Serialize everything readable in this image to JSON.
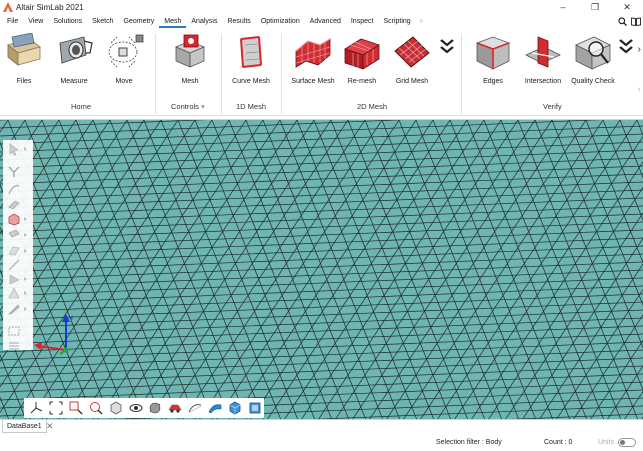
{
  "window": {
    "title": "Altair SimLab 2021",
    "controls": {
      "minimize": "–",
      "maximize": "❐",
      "close": "✕"
    }
  },
  "menu": {
    "items": [
      "File",
      "View",
      "Solutions",
      "Sketch",
      "Geometry",
      "Mesh",
      "Analysis",
      "Results",
      "Optimization",
      "Advanced",
      "Inspect",
      "Scripting"
    ],
    "active": "Mesh",
    "add_tab": "+",
    "right_icons": [
      "search-icon",
      "book-icon"
    ]
  },
  "ribbon": {
    "buttons": {
      "files": "Files",
      "measure": "Measure",
      "move": "Move",
      "mesh": "Mesh",
      "curve_mesh": "Curve Mesh",
      "surface_mesh": "Surface Mesh",
      "remesh": "Re-mesh",
      "grid_mesh": "Grid Mesh",
      "edges": "Edges",
      "intersection": "Intersection",
      "quality_check": "Quality Check"
    },
    "groups": {
      "home": "Home",
      "controls": "Controls",
      "one_d": "1D Mesh",
      "two_d": "2D Mesh",
      "verify": "Verify"
    },
    "more": "»",
    "collapse": "‹",
    "controls_arrow": "▾"
  },
  "viewport": {
    "mesh_color": "#6fb5b2",
    "mesh_line_color": "#1b2b2b",
    "triad": {
      "z_label": "z"
    }
  },
  "side_tools": [
    "select-icon",
    "split-icon",
    "curve-icon",
    "surface-icon",
    "cube-icon",
    "prism-icon",
    "plane-icon",
    "line-icon",
    "wedge-icon",
    "cone-icon",
    "pencil-icon",
    "box-select-icon",
    "layers-icon"
  ],
  "bottom_tools": [
    "axis-icon",
    "fit-icon",
    "zoom-box-icon",
    "zoom-icon",
    "view-cube-icon",
    "eye-icon",
    "hide-icon",
    "car-icon",
    "pencil-wire-icon",
    "shaded-icon",
    "cube-shaded-icon",
    "cube-front-icon"
  ],
  "tabs": {
    "database": "DataBase1",
    "close": "✕"
  },
  "status": {
    "selection_filter": "Selection filter : Body",
    "count": "Count : 0",
    "units": "Units"
  }
}
